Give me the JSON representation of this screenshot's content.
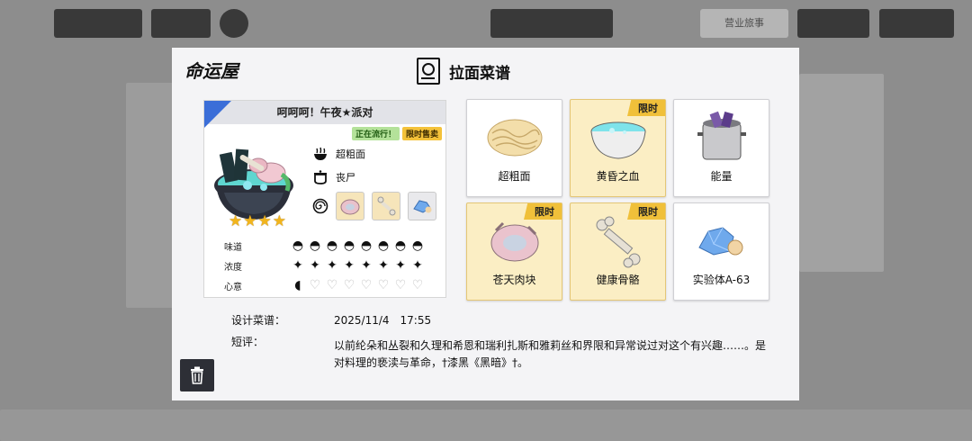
{
  "background": {
    "top_right_tab": "营业旅事"
  },
  "modal": {
    "logo_text": "命运屋",
    "title": "拉面菜谱",
    "card": {
      "dish_name": "呵呵呵！午夜★派对",
      "tag_trending": "正在流行！",
      "tag_limited": "限时售卖",
      "noodle_name": "超粗面",
      "soup_name": "丧尸",
      "stars": 4,
      "stats": [
        {
          "label": "味道",
          "value": 8,
          "max": 8
        },
        {
          "label": "浓度",
          "value": 8,
          "max": 8
        },
        {
          "label": "心意",
          "value": 0.5,
          "max": 8
        }
      ]
    },
    "info": {
      "design_label": "设计菜谱：",
      "design_value": "2025/11/4　17:55",
      "review_label": "短评：",
      "review_text": "以前纶朵和丛裂和久理和希恩和瑞利扎斯和雅莉丝和界限和异常说过对这个有兴趣……。是对料理的亵渎与革命，†漆黑《黑暗》†。"
    },
    "ingredients": [
      {
        "name": "超粗面",
        "limited": false,
        "badge": "",
        "icon": "noodles-icon"
      },
      {
        "name": "黄昏之血",
        "limited": true,
        "badge": "限时",
        "icon": "soup-bowl-icon"
      },
      {
        "name": "能量",
        "limited": false,
        "badge": "",
        "icon": "pot-icon"
      },
      {
        "name": "苍天肉块",
        "limited": true,
        "badge": "限时",
        "icon": "meat-icon"
      },
      {
        "name": "健康骨骼",
        "limited": true,
        "badge": "限时",
        "icon": "bone-icon"
      },
      {
        "name": "实验体A-63",
        "limited": false,
        "badge": "",
        "icon": "crystal-icon"
      }
    ]
  },
  "colors": {
    "accent_blue": "#3b6ed8",
    "gold": "#f0c03a",
    "card_gold_bg": "#fbeec4",
    "trash_bg": "#2d2f36"
  }
}
